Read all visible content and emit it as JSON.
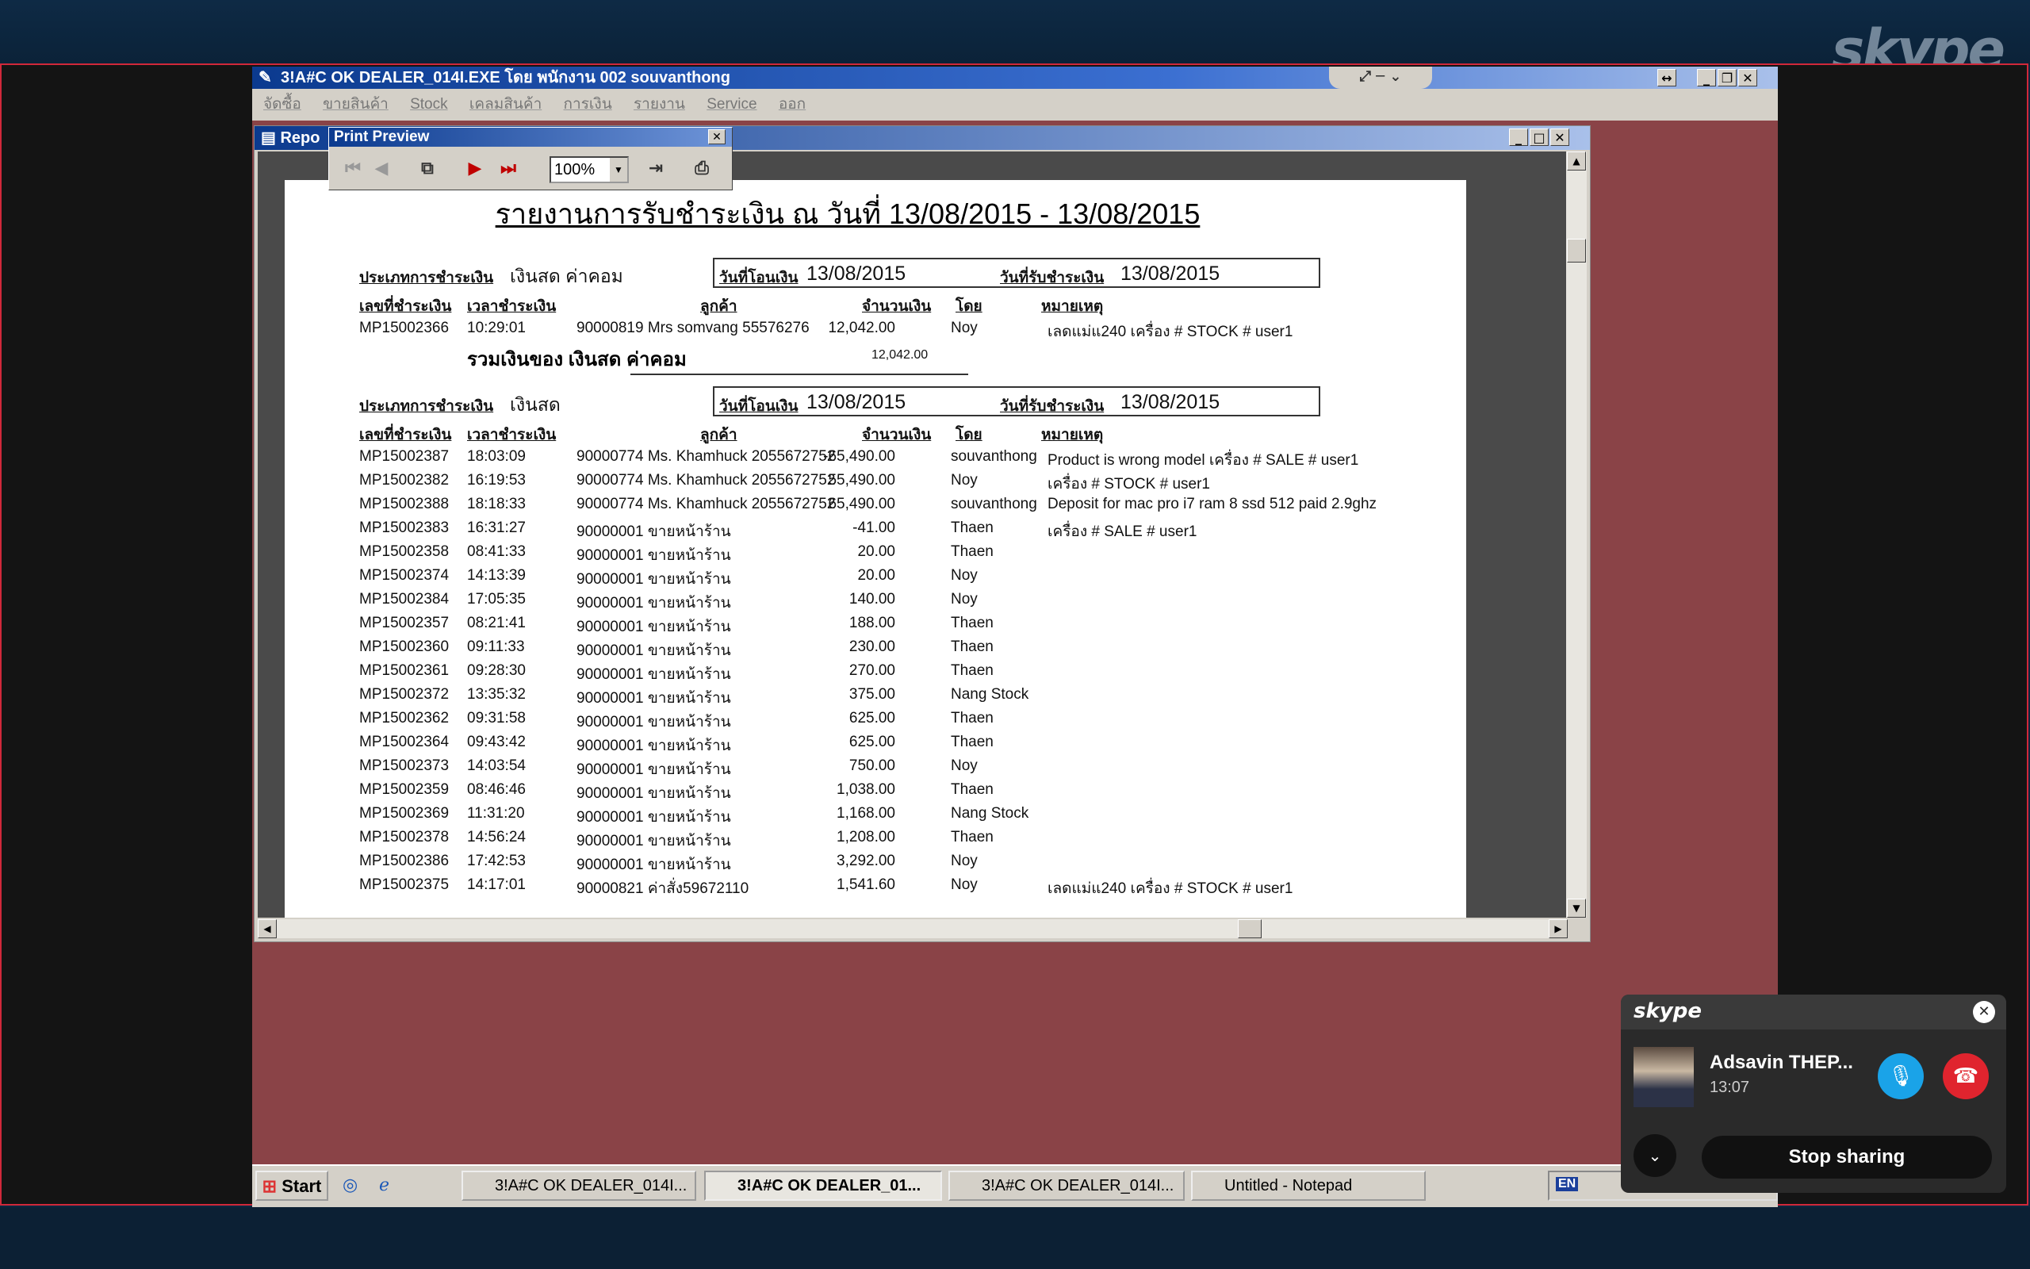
{
  "main_window": {
    "title": "3!A#C OK DEALER_014I.EXE โดย พนักงาน 002 souvanthong",
    "menu": [
      "จัดซื้อ",
      "ขายสินค้า",
      "Stock",
      "เคลมสินค้า",
      "การเงิน",
      "รายงาน",
      "Service",
      "ออก"
    ]
  },
  "report_window": {
    "title": "Repo"
  },
  "print_preview": {
    "title": "Print Preview",
    "zoom": "100%"
  },
  "report": {
    "title": "รายงานการรับชำระเงิน ณ วันที่ 13/08/2015 - 13/08/2015",
    "labels": {
      "payment_type": "ประเภทการชำระเงิน",
      "transfer_date": "วันที่โอนเงิน",
      "receive_date": "วันที่รับชำระเงิน",
      "col_no": "เลขที่ชำระเงิน",
      "col_time": "เวลาชำระเงิน",
      "col_customer": "ลูกค้า",
      "col_amount": "จำนวนเงิน",
      "col_by": "โดย",
      "col_note": "หมายเหตุ"
    },
    "section1": {
      "type": "เงินสด ค่าคอม",
      "transfer_date": "13/08/2015",
      "receive_date": "13/08/2015",
      "rows": [
        {
          "no": "MP15002366",
          "time": "10:29:01",
          "customer": "90000819 Mrs  somvang 55576276",
          "amount": "12,042.00",
          "by": "Noy",
          "note": "เลดแม่แ240 เครื่อง # STOCK # user1"
        }
      ],
      "total_label": "รวมเงินของ เงินสด ค่าคอม",
      "total": "12,042.00"
    },
    "section2": {
      "type": "เงินสด",
      "transfer_date": "13/08/2015",
      "receive_date": "13/08/2015",
      "rows": [
        {
          "no": "MP15002387",
          "time": "18:03:09",
          "customer": "90000774 Ms. Khamhuck 2055672752",
          "amount": "-65,490.00",
          "by": "souvanthong",
          "note": "Product is wrong model เครื่อง # SALE # user1"
        },
        {
          "no": "MP15002382",
          "time": "16:19:53",
          "customer": "90000774 Ms. Khamhuck 2055672752",
          "amount": "55,490.00",
          "by": "Noy",
          "note": "เครื่อง # STOCK # user1"
        },
        {
          "no": "MP15002388",
          "time": "18:18:33",
          "customer": "90000774 Ms. Khamhuck 2055672752",
          "amount": "65,490.00",
          "by": "souvanthong",
          "note": "Deposit for mac pro i7 ram 8 ssd 512 paid  2.9ghz"
        },
        {
          "no": "MP15002383",
          "time": "16:31:27",
          "customer": "90000001 ขายหน้าร้าน",
          "amount": "-41.00",
          "by": "Thaen",
          "note": "เครื่อง # SALE # user1"
        },
        {
          "no": "MP15002358",
          "time": "08:41:33",
          "customer": "90000001 ขายหน้าร้าน",
          "amount": "20.00",
          "by": "Thaen",
          "note": ""
        },
        {
          "no": "MP15002374",
          "time": "14:13:39",
          "customer": "90000001 ขายหน้าร้าน",
          "amount": "20.00",
          "by": "Noy",
          "note": ""
        },
        {
          "no": "MP15002384",
          "time": "17:05:35",
          "customer": "90000001 ขายหน้าร้าน",
          "amount": "140.00",
          "by": "Noy",
          "note": ""
        },
        {
          "no": "MP15002357",
          "time": "08:21:41",
          "customer": "90000001 ขายหน้าร้าน",
          "amount": "188.00",
          "by": "Thaen",
          "note": ""
        },
        {
          "no": "MP15002360",
          "time": "09:11:33",
          "customer": "90000001 ขายหน้าร้าน",
          "amount": "230.00",
          "by": "Thaen",
          "note": ""
        },
        {
          "no": "MP15002361",
          "time": "09:28:30",
          "customer": "90000001 ขายหน้าร้าน",
          "amount": "270.00",
          "by": "Thaen",
          "note": ""
        },
        {
          "no": "MP15002372",
          "time": "13:35:32",
          "customer": "90000001 ขายหน้าร้าน",
          "amount": "375.00",
          "by": "Nang Stock",
          "note": ""
        },
        {
          "no": "MP15002362",
          "time": "09:31:58",
          "customer": "90000001 ขายหน้าร้าน",
          "amount": "625.00",
          "by": "Thaen",
          "note": ""
        },
        {
          "no": "MP15002364",
          "time": "09:43:42",
          "customer": "90000001 ขายหน้าร้าน",
          "amount": "625.00",
          "by": "Thaen",
          "note": ""
        },
        {
          "no": "MP15002373",
          "time": "14:03:54",
          "customer": "90000001 ขายหน้าร้าน",
          "amount": "750.00",
          "by": "Noy",
          "note": ""
        },
        {
          "no": "MP15002359",
          "time": "08:46:46",
          "customer": "90000001 ขายหน้าร้าน",
          "amount": "1,038.00",
          "by": "Thaen",
          "note": ""
        },
        {
          "no": "MP15002369",
          "time": "11:31:20",
          "customer": "90000001 ขายหน้าร้าน",
          "amount": "1,168.00",
          "by": "Nang Stock",
          "note": ""
        },
        {
          "no": "MP15002378",
          "time": "14:56:24",
          "customer": "90000001 ขายหน้าร้าน",
          "amount": "1,208.00",
          "by": "Thaen",
          "note": ""
        },
        {
          "no": "MP15002386",
          "time": "17:42:53",
          "customer": "90000001 ขายหน้าร้าน",
          "amount": "3,292.00",
          "by": "Noy",
          "note": ""
        },
        {
          "no": "MP15002375",
          "time": "14:17:01",
          "customer": "90000821 ค่าสั่ง59672110",
          "amount": "1,541.60",
          "by": "Noy",
          "note": "เลดแม่แ240 เครื่อง # STOCK # user1"
        }
      ]
    }
  },
  "taskbar": {
    "start": "Start",
    "tasks": [
      "3!A#C OK DEALER_014I...",
      "3!A#C OK DEALER_01...",
      "3!A#C OK DEALER_014I...",
      "Untitled - Notepad"
    ],
    "lang": "EN"
  },
  "skype": {
    "watermark": "skype",
    "call": {
      "logo": "skype",
      "name": "Adsavin THEP...",
      "time": "13:07",
      "stop_label": "Stop sharing"
    }
  }
}
